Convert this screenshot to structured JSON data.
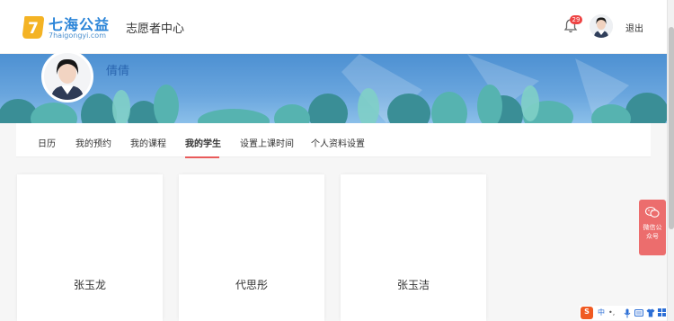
{
  "header": {
    "logo_title": "七海公益",
    "logo_sub": "7haigongyi.com",
    "logo_badge": "7",
    "nav_title": "志愿者中心",
    "notification_count": "29",
    "logout": "退出"
  },
  "profile": {
    "username": "倩倩"
  },
  "tabs": [
    {
      "label": "日历",
      "active": false
    },
    {
      "label": "我的预约",
      "active": false
    },
    {
      "label": "我的课程",
      "active": false
    },
    {
      "label": "我的学生",
      "active": true
    },
    {
      "label": "设置上课时间",
      "active": false
    },
    {
      "label": "个人资料设置",
      "active": false
    }
  ],
  "students": [
    {
      "name": "张玉龙"
    },
    {
      "name": "代思彤"
    },
    {
      "name": "张玉洁"
    }
  ],
  "wechat": {
    "label": "微信公众号"
  },
  "ime": {
    "logo": "S",
    "mode": "中",
    "punct": "•,",
    "icons": [
      "microphone-icon",
      "keyboard-icon",
      "clothes-icon",
      "grid-icon"
    ]
  },
  "colors": {
    "brand_blue": "#2a84d8",
    "accent_red": "#e95b5b",
    "badge_red": "#e44444",
    "wechat_bg": "#ec6d6d"
  }
}
